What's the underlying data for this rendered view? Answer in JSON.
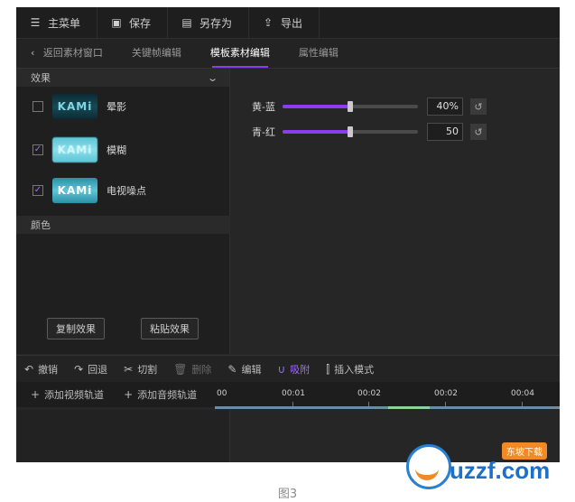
{
  "toolbar": {
    "menu_label": "主菜单",
    "save_label": "保存",
    "save_as_label": "另存为",
    "export_label": "导出"
  },
  "tabs": {
    "back_label": "返回素材窗口",
    "keyframe_label": "关键帧编辑",
    "template_label": "模板素材编辑",
    "attr_label": "属性编辑"
  },
  "effects": {
    "header": "效果",
    "items": [
      {
        "label": "晕影",
        "checked": false,
        "thumb_text": "KAMi"
      },
      {
        "label": "模糊",
        "checked": true,
        "thumb_text": "KAMi"
      },
      {
        "label": "电视噪点",
        "checked": true,
        "thumb_text": "KAMi"
      }
    ],
    "color_header": "颜色",
    "copy_label": "复制效果",
    "paste_label": "粘贴效果"
  },
  "params": {
    "items": [
      {
        "label": "黄-蓝",
        "value": "40%",
        "level": 0.5
      },
      {
        "label": "青-红",
        "value": "50",
        "level": 0.5
      }
    ]
  },
  "timeline": {
    "undo": "撤销",
    "redo": "回退",
    "cut": "切割",
    "delete": "删除",
    "edit": "编辑",
    "snap": "吸附",
    "insert_mode": "插入模式",
    "add_video": "添加视频轨道",
    "add_audio": "添加音频轨道",
    "ticks": [
      "00",
      "00:01",
      "00:02",
      "00:02",
      "00:04"
    ]
  },
  "caption": "图3",
  "watermark": {
    "word": "uzzf.com",
    "tag": "东坡下载"
  },
  "colors": {
    "accent": "#8a3cf0",
    "background": "#262626"
  }
}
